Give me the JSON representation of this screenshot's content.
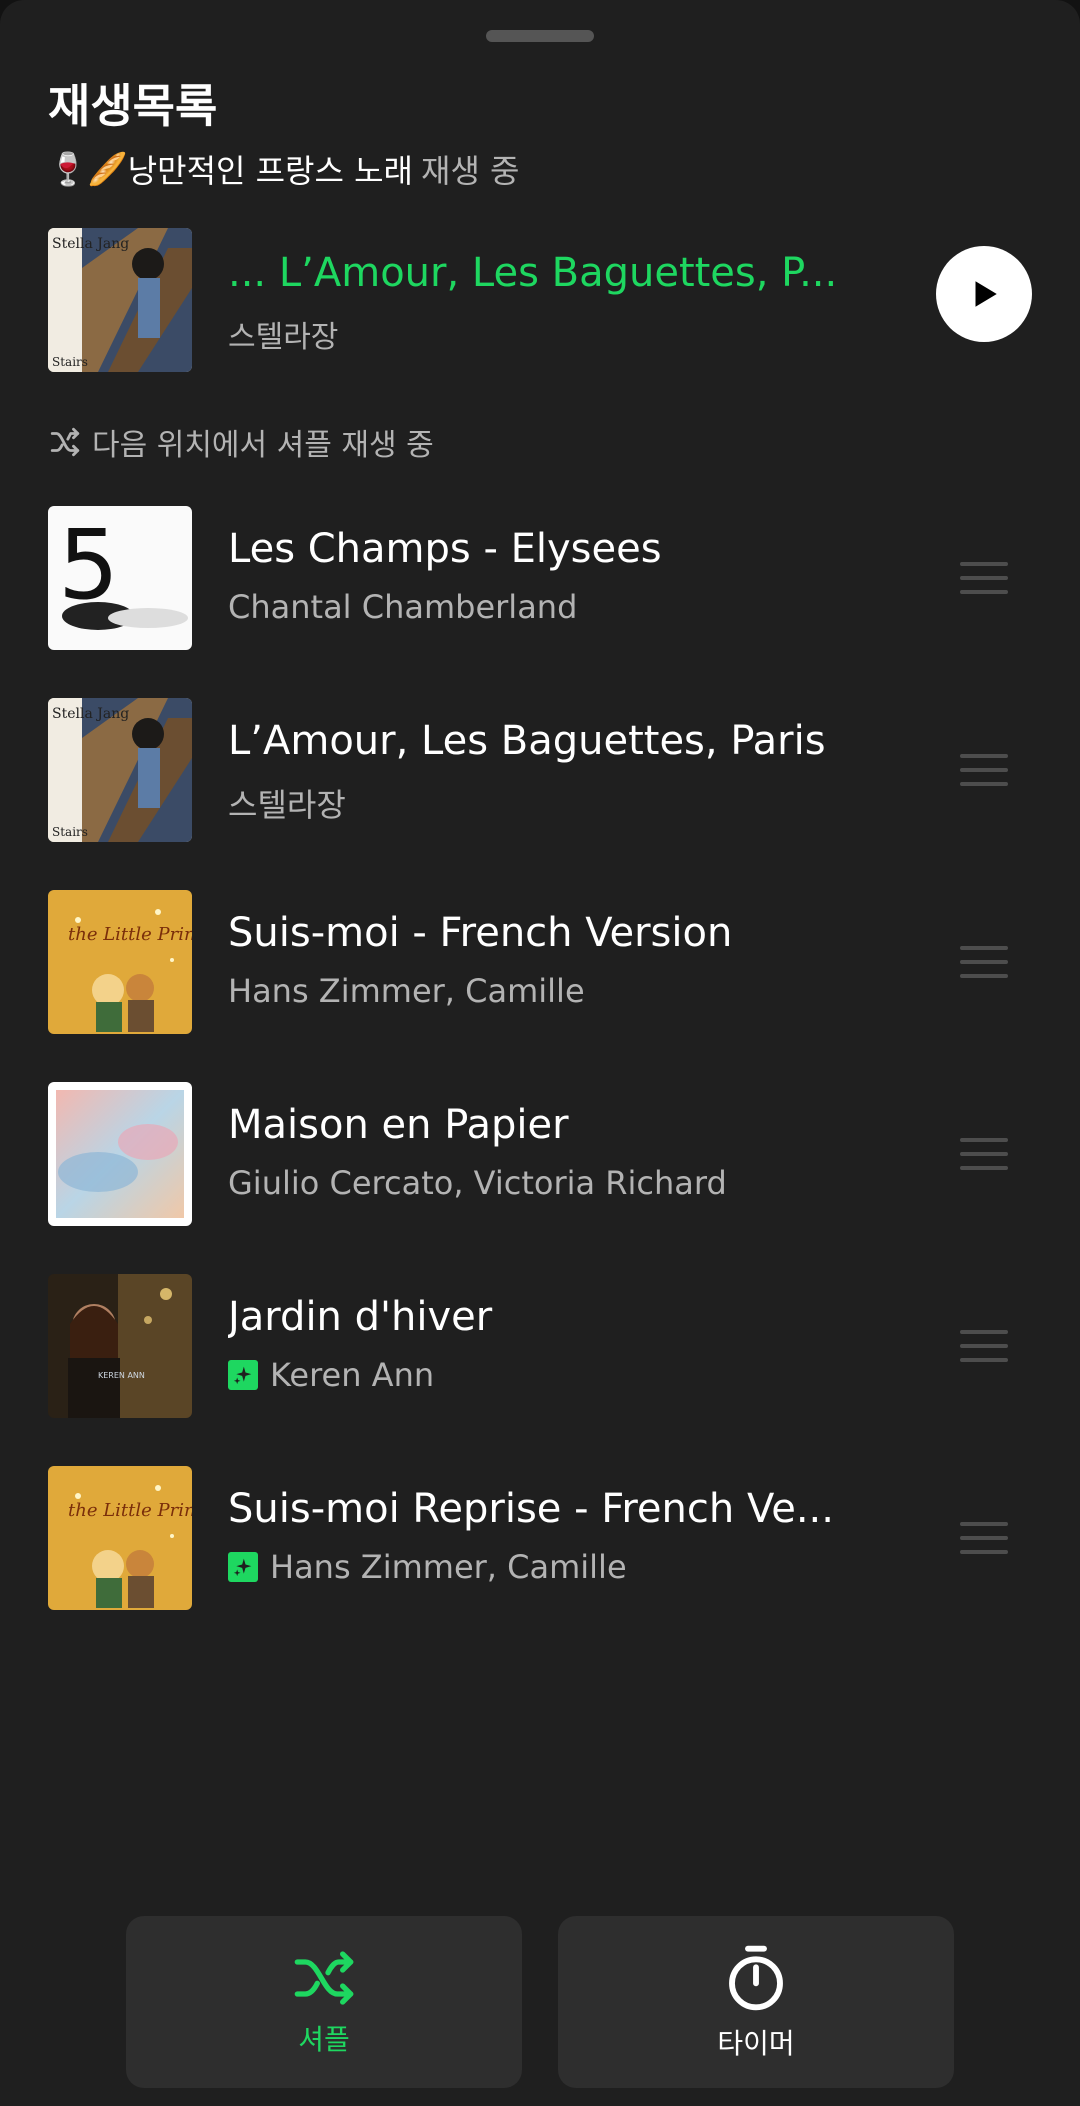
{
  "sheet": {
    "title": "재생목록",
    "context_emoji": "🍷🥖",
    "context_name": "낭만적인 프랑스 노래",
    "context_status": "재생 중"
  },
  "now_playing": {
    "title": "... L’Amour, Les Baguettes, P...",
    "artist": "스텔라장",
    "art": {
      "top_text": "Stella Jang",
      "bottom_text": "Stairs"
    }
  },
  "shuffle_note": "다음 위치에서 셔플 재생 중",
  "queue": [
    {
      "title": "Les Champs - Elysees",
      "artist": "Chantal Chamberland",
      "badge": false,
      "art_caption": "5"
    },
    {
      "title": "L’Amour, Les Baguettes, Paris",
      "artist": "스텔라장",
      "badge": false,
      "art_top": "Stella Jang",
      "art_bottom": "Stairs"
    },
    {
      "title": "Suis-moi - French Version",
      "artist": "Hans Zimmer, Camille",
      "badge": false,
      "art_caption": "the Little Prince"
    },
    {
      "title": "Maison en Papier",
      "artist": "Giulio Cercato, Victoria Richard",
      "badge": false
    },
    {
      "title": "Jardin d'hiver",
      "artist": "Keren Ann",
      "badge": true,
      "art_caption": "KEREN ANN"
    },
    {
      "title": "Suis-moi Reprise - French Ve...",
      "artist": "Hans Zimmer, Camille",
      "badge": true,
      "art_caption": "the Little Prince"
    }
  ],
  "buttons": {
    "shuffle_label": "셔플",
    "timer_label": "타이머"
  },
  "colors": {
    "accent": "#1ed760",
    "background": "#1f1f1f",
    "button_bg": "#2e2e2e",
    "muted_text": "#b3b3b3"
  },
  "icons": [
    "shuffle-icon",
    "play-icon",
    "drag-handle-icon",
    "timer-icon",
    "sparkle-badge-icon"
  ]
}
